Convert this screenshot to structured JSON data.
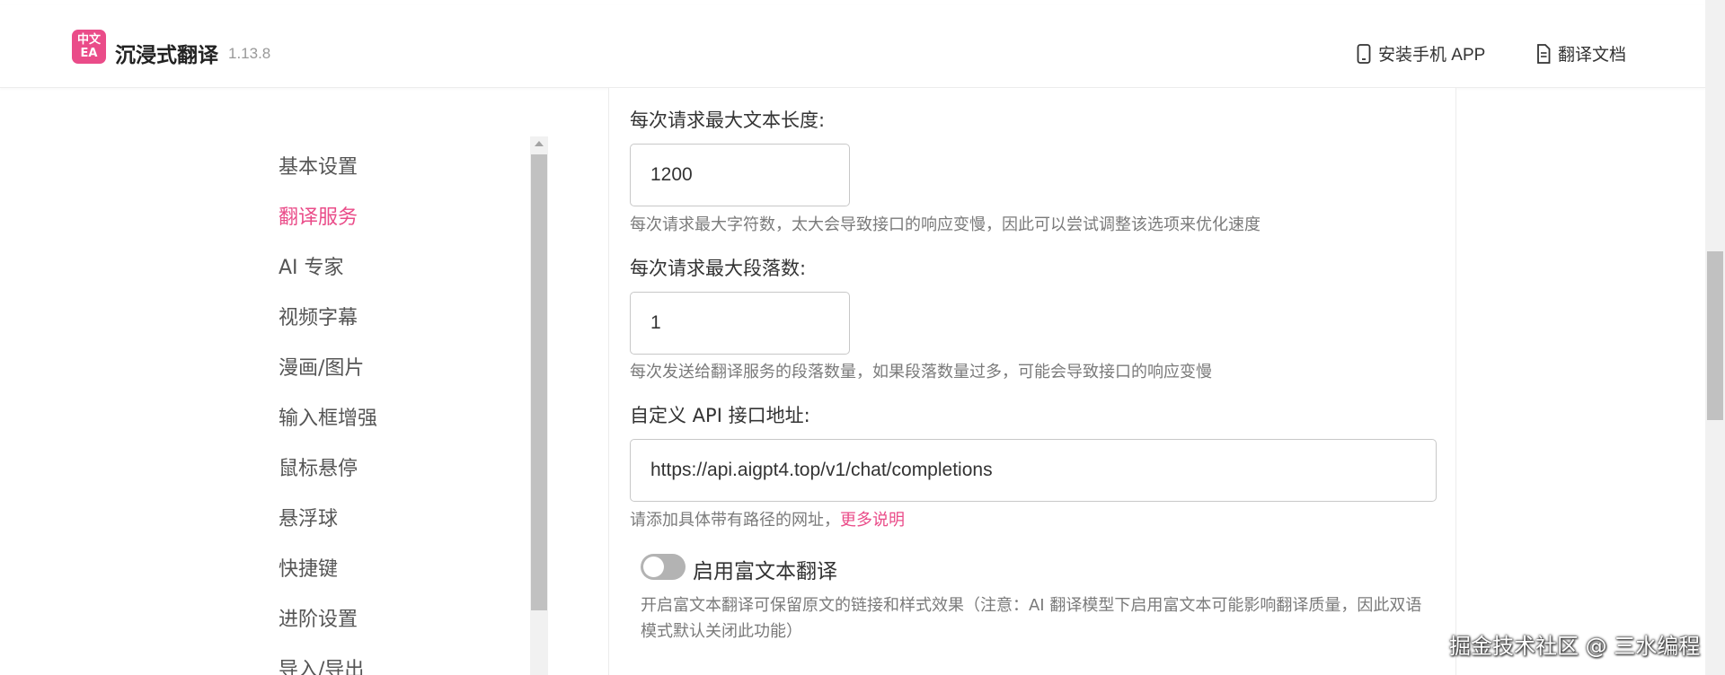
{
  "header": {
    "logo_text_top": "中文",
    "logo_text_bottom": "EA",
    "app_name": "沉浸式翻译",
    "version": "1.13.8",
    "install_app_label": "安装手机 APP",
    "docs_label": "翻译文档"
  },
  "sidebar": {
    "items": [
      {
        "label": "基本设置"
      },
      {
        "label": "翻译服务"
      },
      {
        "label": "AI 专家"
      },
      {
        "label": "视频字幕"
      },
      {
        "label": "漫画/图片"
      },
      {
        "label": "输入框增强"
      },
      {
        "label": "鼠标悬停"
      },
      {
        "label": "悬浮球"
      },
      {
        "label": "快捷键"
      },
      {
        "label": "进阶设置"
      },
      {
        "label": "导入/导出"
      }
    ],
    "active_index": 1
  },
  "settings": {
    "max_text_length": {
      "label": "每次请求最大文本长度:",
      "value": "1200",
      "help": "每次请求最大字符数，太大会导致接口的响应变慢，因此可以尝试调整该选项来优化速度"
    },
    "max_paragraphs": {
      "label": "每次请求最大段落数:",
      "value": "1",
      "help": "每次发送给翻译服务的段落数量，如果段落数量过多，可能会导致接口的响应变慢"
    },
    "api_url": {
      "label": "自定义 API 接口地址:",
      "value": "https://api.aigpt4.top/v1/chat/completions",
      "help": "请添加具体带有路径的网址，",
      "help_link": "更多说明"
    },
    "rich_text": {
      "label": "启用富文本翻译",
      "enabled": false,
      "help": "开启富文本翻译可保留原文的链接和样式效果（注意：AI 翻译模型下启用富文本可能影响翻译质量，因此双语模式默认关闭此功能）"
    }
  },
  "watermark": "掘金技术社区 @ 三水编程",
  "colors": {
    "accent": "#ea4c89",
    "text": "#333333",
    "muted": "#7a7a7a"
  }
}
